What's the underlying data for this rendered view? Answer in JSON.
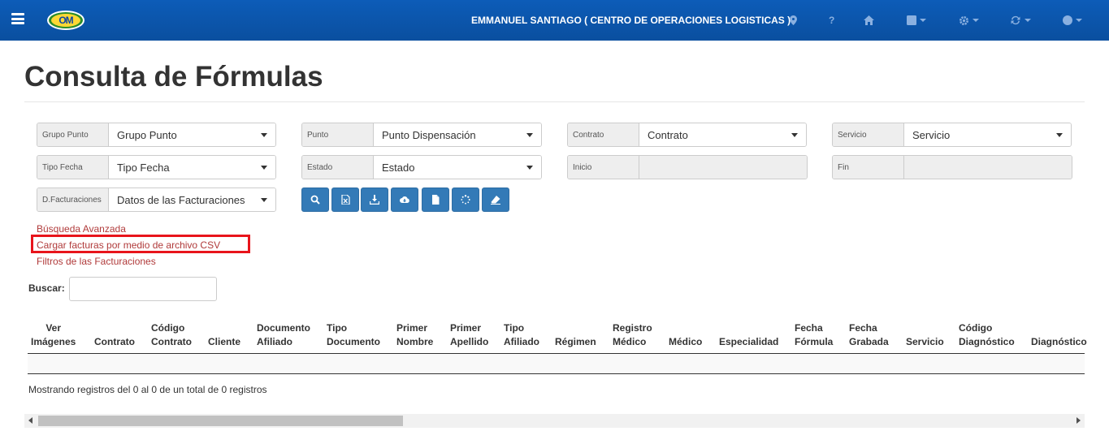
{
  "navbar": {
    "user": "EMMANUEL SANTIAGO ( CENTRO DE OPERACIONES LOGISTICAS )",
    "logo_text": "OM",
    "icons": [
      "map-marker-icon",
      "question-icon",
      "home-icon",
      "square-icon",
      "gear-icon",
      "refresh-icon",
      "user-circle-icon"
    ]
  },
  "page": {
    "title": "Consulta de Fórmulas"
  },
  "filters": {
    "grupo_punto": {
      "label": "Grupo Punto",
      "value": "Grupo Punto"
    },
    "punto": {
      "label": "Punto",
      "value": "Punto Dispensación"
    },
    "contrato": {
      "label": "Contrato",
      "value": "Contrato"
    },
    "servicio": {
      "label": "Servicio",
      "value": "Servicio"
    },
    "tipo_fecha": {
      "label": "Tipo Fecha",
      "value": "Tipo Fecha"
    },
    "estado": {
      "label": "Estado",
      "value": "Estado"
    },
    "inicio": {
      "label": "Inicio",
      "value": ""
    },
    "fin": {
      "label": "Fin",
      "value": ""
    },
    "d_facturaciones": {
      "label": "D.Facturaciones",
      "value": "Datos de las Facturaciones"
    }
  },
  "links": {
    "busqueda": "Búsqueda Avanzada",
    "cargar": "Cargar facturas por medio de archivo CSV",
    "filtros": "Filtros de las Facturaciones"
  },
  "search": {
    "label": "Buscar:",
    "value": ""
  },
  "table": {
    "headers": {
      "ver_imagenes": [
        "Ver",
        "Imágenes"
      ],
      "contrato": [
        "",
        "Contrato"
      ],
      "codigo_contrato": [
        "Código",
        "Contrato"
      ],
      "cliente": [
        "",
        "Cliente"
      ],
      "documento_afiliado": [
        "Documento",
        "Afiliado"
      ],
      "tipo_documento": [
        "Tipo",
        "Documento"
      ],
      "primer_nombre": [
        "Primer",
        "Nombre"
      ],
      "primer_apellido": [
        "Primer",
        "Apellido"
      ],
      "tipo_afiliado": [
        "Tipo",
        "Afiliado"
      ],
      "regimen": [
        "",
        "Régimen"
      ],
      "registro_medico": [
        "Registro",
        "Médico"
      ],
      "medico": [
        "",
        "Médico"
      ],
      "especialidad": [
        "",
        "Especialidad"
      ],
      "fecha_formula": [
        "Fecha",
        "Fórmula"
      ],
      "fecha_grabada": [
        "Fecha",
        "Grabada"
      ],
      "servicio": [
        "",
        "Servicio"
      ],
      "codigo_diagnostico": [
        "Código",
        "Diagnóstico"
      ],
      "diagnostico": [
        "",
        "Diagnóstico"
      ]
    },
    "info": "Mostrando registros del 0 al 0 de un total de 0 registros"
  },
  "scrollbar": {
    "position_fraction": 0.0
  },
  "colors": {
    "navbar": "#0a4f9f",
    "link": "#b03a3a",
    "button": "#337ab7",
    "highlight": "#e8141b"
  }
}
